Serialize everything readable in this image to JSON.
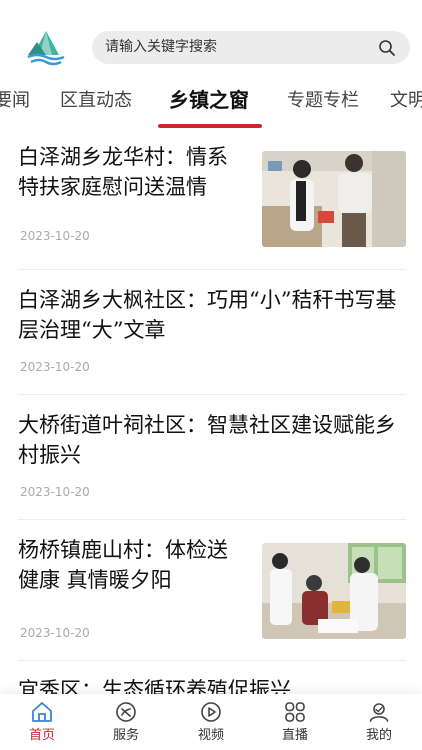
{
  "search": {
    "placeholder": "请输入关键字搜索"
  },
  "tabs": [
    {
      "label": "要闻",
      "active": false
    },
    {
      "label": "区直动态",
      "active": false
    },
    {
      "label": "乡镇之窗",
      "active": true
    },
    {
      "label": "专题专栏",
      "active": false
    },
    {
      "label": "文明",
      "active": false
    }
  ],
  "articles": [
    {
      "title": "白泽湖乡龙华村：情系特扶家庭慰问送温情",
      "date": "2023-10-20",
      "has_image": true
    },
    {
      "title": "白泽湖乡大枫社区：巧用“小”秸秆书写基层治理“大”文章",
      "date": "2023-10-20",
      "has_image": false
    },
    {
      "title": "大桥街道叶祠社区：智慧社区建设赋能乡村振兴",
      "date": "2023-10-20",
      "has_image": false
    },
    {
      "title": "杨桥镇鹿山村：体检送健康 真情暖夕阳",
      "date": "2023-10-20",
      "has_image": true
    },
    {
      "title": "宜秀区：生态循环养殖促振兴",
      "date": "",
      "has_image": false
    }
  ],
  "bottom_nav": [
    {
      "label": "首页",
      "icon": "home-icon",
      "active": true
    },
    {
      "label": "服务",
      "icon": "service-icon",
      "active": false
    },
    {
      "label": "视频",
      "icon": "video-icon",
      "active": false
    },
    {
      "label": "直播",
      "icon": "live-grid-icon",
      "active": false
    },
    {
      "label": "我的",
      "icon": "user-icon",
      "active": false
    }
  ],
  "colors": {
    "accent": "#c8282e",
    "search_bg": "#ececec",
    "logo_teal": "#3aa6a0"
  }
}
